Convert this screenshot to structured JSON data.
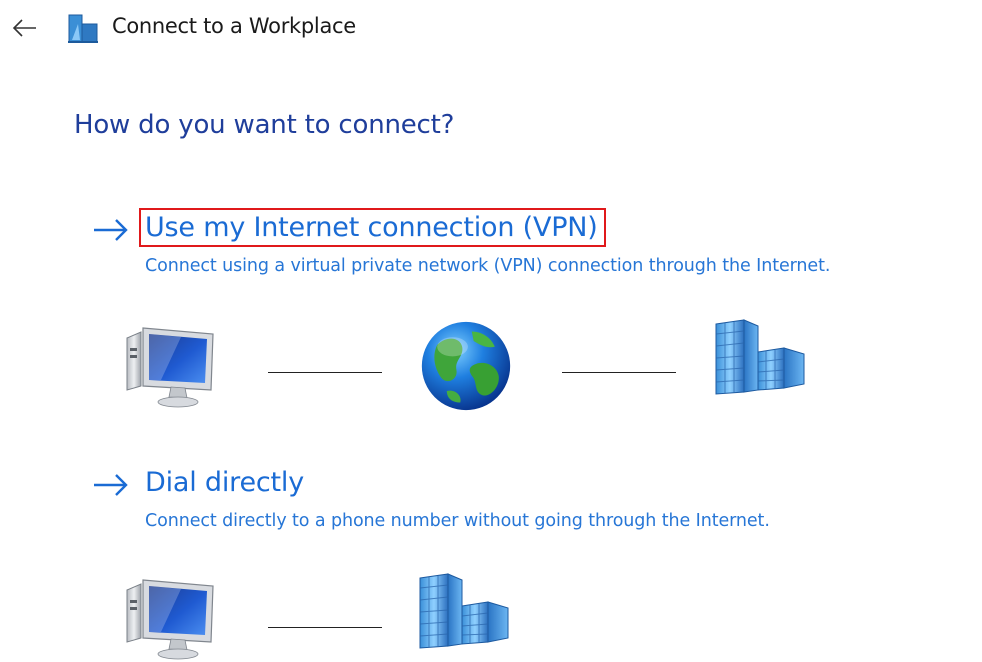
{
  "header": {
    "back_icon": "arrow-left-icon",
    "app_icon": "workplace-building-icon",
    "title": "Connect to a Workplace"
  },
  "main": {
    "heading": "How do you want to connect?",
    "options": [
      {
        "label": "Use my Internet connection (VPN)",
        "description": "Connect using a virtual private network (VPN) connection through the Internet.",
        "arrow_icon": "arrow-right-icon",
        "diagram_icons": [
          "computer-icon",
          "globe-icon",
          "office-building-icon"
        ]
      },
      {
        "label": "Dial directly",
        "description": "Connect directly to a phone number without going through the Internet.",
        "arrow_icon": "arrow-right-icon",
        "diagram_icons": [
          "computer-icon",
          "office-building-icon"
        ]
      }
    ]
  },
  "colors": {
    "heading": "#1f3e9b",
    "link": "#1a6bd4",
    "description": "#2776d6",
    "highlight_box": "#e0191b"
  }
}
